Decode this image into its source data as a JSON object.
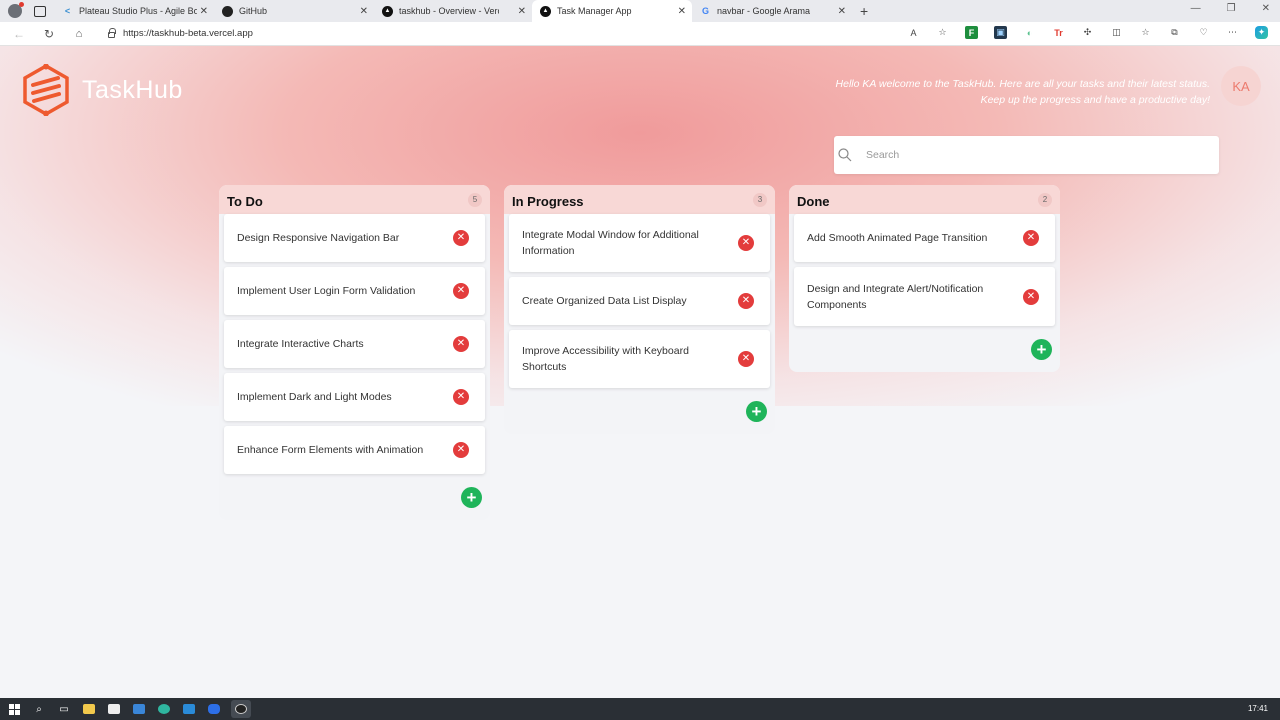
{
  "browser": {
    "tabs": [
      {
        "title": "Plateau Studio Plus - Agile Board",
        "icon": "plateau-icon"
      },
      {
        "title": "GitHub",
        "icon": "github-icon"
      },
      {
        "title": "taskhub - Overview - Vercel",
        "icon": "vercel-icon"
      },
      {
        "title": "Task Manager App",
        "icon": "vercel-icon",
        "active": true
      },
      {
        "title": "navbar - Google Arama",
        "icon": "google-icon"
      }
    ],
    "url": "https://taskhub-beta.vercel.app"
  },
  "header": {
    "brand": "TaskHub",
    "welcome": "Hello KA welcome to the TaskHub. Here are all your tasks and their latest status. Keep up the progress and have a productive day!",
    "avatar_initials": "KA",
    "search_placeholder": "Search",
    "colors": {
      "brand": "#ee5a2f",
      "add": "#1fb45a",
      "delete": "#e33c3c",
      "column_header": "#f8d8d6"
    }
  },
  "columns": [
    {
      "title": "To Do",
      "count": "5",
      "cards": [
        "Design Responsive Navigation Bar",
        "Implement User Login Form Validation",
        "Integrate Interactive Charts",
        "Implement Dark and Light Modes",
        "Enhance Form Elements with Animation"
      ]
    },
    {
      "title": "In Progress",
      "count": "3",
      "cards": [
        "Integrate Modal Window for Additional Information",
        "Create Organized Data List Display",
        "Improve Accessibility with Keyboard Shortcuts"
      ]
    },
    {
      "title": "Done",
      "count": "2",
      "cards": [
        "Add Smooth Animated Page Transition",
        "Design and Integrate Alert/Notification Components"
      ]
    }
  ],
  "taskbar": {
    "time": "17:41"
  }
}
